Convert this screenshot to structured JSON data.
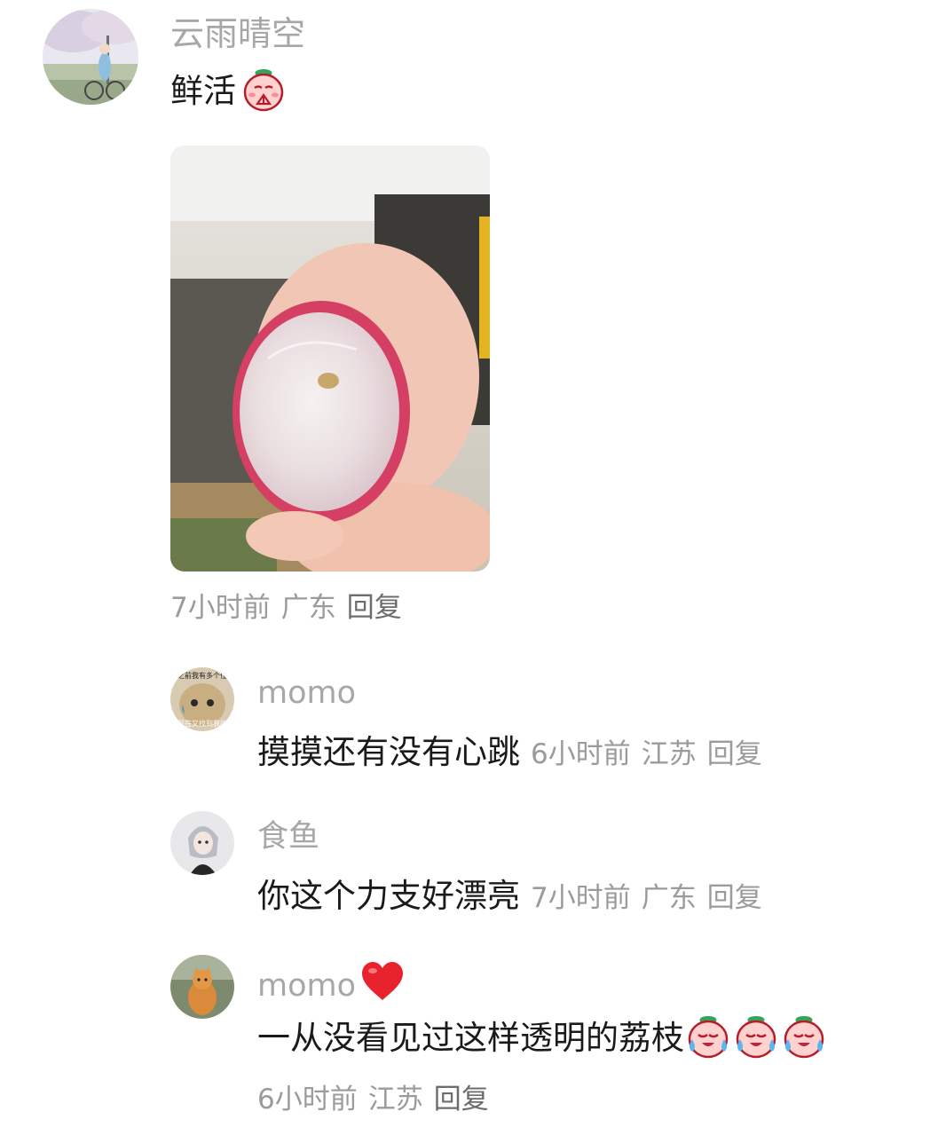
{
  "comment": {
    "author": "云雨晴空",
    "text": "鲜活",
    "time": "7小时前",
    "location": "广东",
    "reply_label": "回复"
  },
  "replies": [
    {
      "author": "momo",
      "text": "摸摸还有没有心跳",
      "time": "6小时前",
      "location": "江苏",
      "reply_label": "回复",
      "avatar_caption_top": "之前我有多个位",
      "avatar_caption_bottom": "现在又找到我的"
    },
    {
      "author": "食鱼",
      "text": "你这个力支好漂亮",
      "time": "7小时前",
      "location": "广东",
      "reply_label": "回复"
    },
    {
      "author": "momo",
      "text": "一从没看见过这样透明的荔枝",
      "time": "6小时前",
      "location": "江苏",
      "reply_label": "回复"
    }
  ],
  "icons": {
    "sticker_pray": "peach-pray-sticker-icon",
    "sticker_cry": "peach-cry-sticker-icon",
    "heart": "heart-icon"
  },
  "colors": {
    "name": "#a7a7a7",
    "text": "#1a1a1a",
    "meta": "#9b9b9b",
    "heart": "#e8232e"
  }
}
